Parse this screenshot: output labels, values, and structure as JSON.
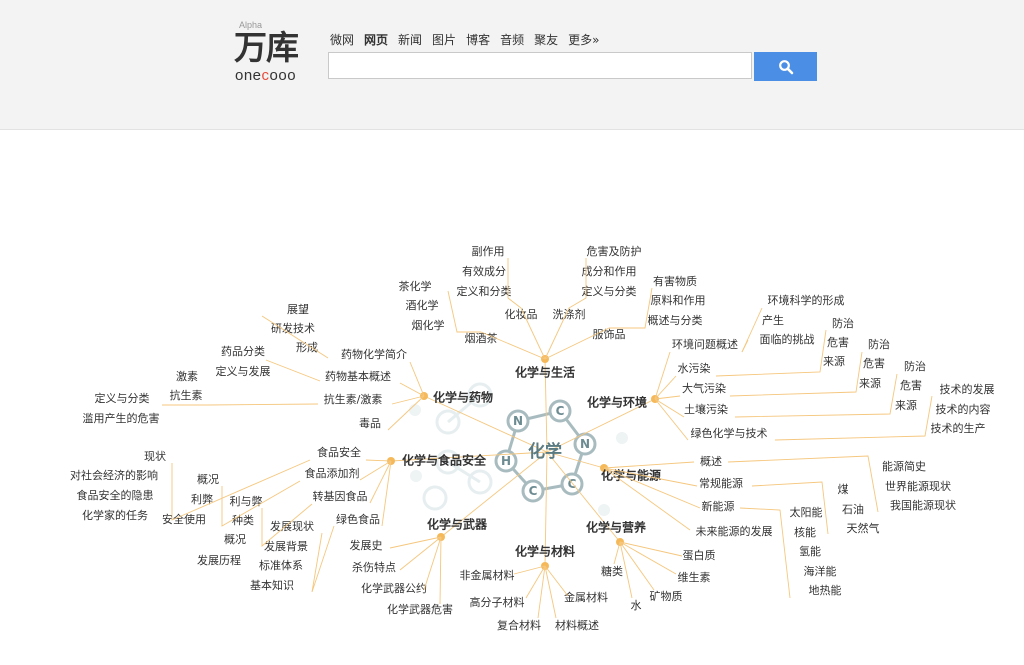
{
  "header": {
    "logo": {
      "alpha": "Alpha",
      "main": "万库",
      "sub_pre": "one",
      "sub_c": "c",
      "sub_post": "ooo"
    },
    "nav": [
      "微网",
      "网页",
      "新闻",
      "图片",
      "博客",
      "音频",
      "聚友",
      "更多»"
    ],
    "active_nav": "网页",
    "search": {
      "value": "",
      "placeholder": ""
    },
    "search_icon": "search-icon",
    "accent": "#4a8ee6"
  },
  "mindmap": {
    "center": "化学",
    "ring_atoms": [
      "N",
      "C",
      "N",
      "C",
      "C",
      "H"
    ],
    "colors": {
      "link": "#f5c77e",
      "node": "#f5b95a",
      "ring": "#a8bcc0",
      "text": "#333333"
    },
    "branches": [
      {
        "label": "化学与生活",
        "children": [
          "副作用",
          "有效成分",
          "定义和分类",
          "化妆品",
          "洗涤剂",
          "危害及防护",
          "成分和作用",
          "定义与分类",
          "茶化学",
          "酒化学",
          "烟化学",
          "烟酒茶",
          "服饰品",
          "有害物质",
          "原料和作用",
          "概述与分类"
        ]
      },
      {
        "label": "化学与药物",
        "children": [
          "展望",
          "研发技术",
          "形成",
          "药物化学简介",
          "药品分类",
          "定义与发展",
          "药物基本概述",
          "激素",
          "抗生素",
          "定义与分类",
          "滥用产生的危害",
          "抗生素/激素",
          "毒品"
        ]
      },
      {
        "label": "化学与环境",
        "children": [
          "环境问题概述",
          "环境科学的形成",
          "产生",
          "面临的挑战",
          "水污染",
          "防治",
          "危害",
          "来源",
          "大气污染",
          "防治",
          "危害",
          "来源",
          "土壤污染",
          "防治",
          "危害",
          "来源",
          "绿色化学与技术",
          "技术的发展",
          "技术的内容",
          "技术的生产"
        ]
      },
      {
        "label": "化学与食品安全",
        "children": [
          "食品安全",
          "食品添加剂",
          "转基因食品",
          "绿色食品",
          "现状",
          "对社会经济的影响",
          "食品安全的隐患",
          "化学家的任务",
          "概况",
          "利弊",
          "安全使用",
          "利与弊",
          "种类",
          "概况",
          "发展现状",
          "发展背景",
          "标准体系",
          "发展历程",
          "基本知识"
        ]
      },
      {
        "label": "化学与能源",
        "children": [
          "概述",
          "常规能源",
          "新能源",
          "未来能源的发展",
          "能源简史",
          "世界能源现状",
          "我国能源现状",
          "煤",
          "石油",
          "天然气",
          "太阳能",
          "核能",
          "氢能",
          "海洋能",
          "地热能"
        ]
      },
      {
        "label": "化学与武器",
        "children": [
          "发展史",
          "杀伤特点",
          "化学武器公约",
          "化学武器危害"
        ]
      },
      {
        "label": "化学与材料",
        "children": [
          "非金属材料",
          "高分子材料",
          "复合材料",
          "材料概述",
          "金属材料"
        ]
      },
      {
        "label": "化学与营养",
        "children": [
          "糖类",
          "水",
          "矿物质",
          "维生素",
          "蛋白质"
        ]
      }
    ]
  }
}
